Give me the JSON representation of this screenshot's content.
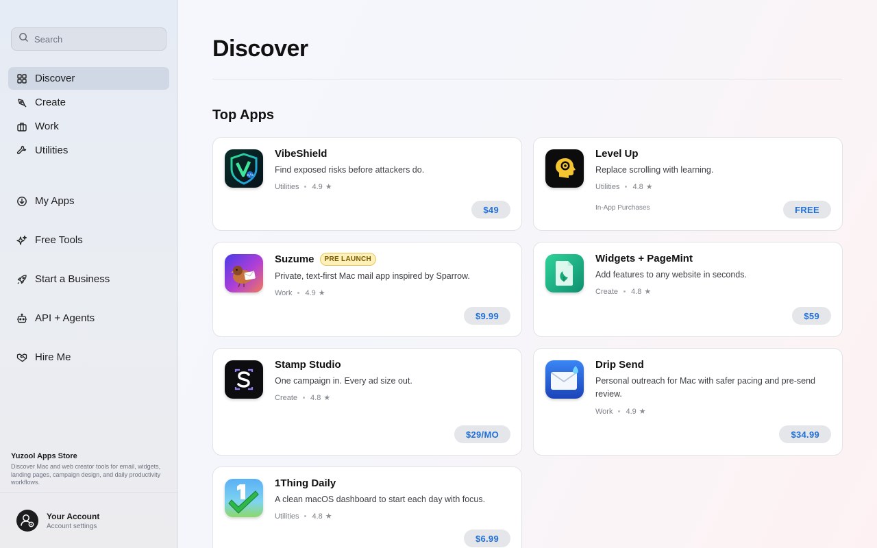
{
  "sidebar": {
    "search_placeholder": "Search",
    "nav": [
      {
        "label": "Discover",
        "icon": "grid-icon"
      },
      {
        "label": "Create",
        "icon": "pen-tool-icon"
      },
      {
        "label": "Work",
        "icon": "briefcase-icon"
      },
      {
        "label": "Utilities",
        "icon": "wrench-icon"
      },
      {
        "label": "My Apps",
        "icon": "download-circle-icon"
      },
      {
        "label": "Free Tools",
        "icon": "sparkles-icon"
      },
      {
        "label": "Start a Business",
        "icon": "rocket-icon"
      },
      {
        "label": "API + Agents",
        "icon": "robot-icon"
      },
      {
        "label": "Hire Me",
        "icon": "handshake-icon"
      }
    ],
    "store_title": "Yuzool Apps Store",
    "store_desc": "Discover Mac and web creator tools for email, widgets, landing pages, campaign design, and daily productivity workflows.",
    "account_name": "Your Account",
    "account_sub": "Account settings"
  },
  "main": {
    "title": "Discover",
    "section_title": "Top Apps",
    "apps": [
      {
        "name": "VibeShield",
        "desc": "Find exposed risks before attackers do.",
        "category": "Utilities",
        "rating": "4.9",
        "price": "$49"
      },
      {
        "name": "Level Up",
        "desc": "Replace scrolling with learning.",
        "category": "Utilities",
        "rating": "4.8",
        "extra": "In-App Purchases",
        "price": "FREE"
      },
      {
        "name": "Suzume",
        "badge": "PRE LAUNCH",
        "desc": "Private, text-first Mac mail app inspired by Sparrow.",
        "category": "Work",
        "rating": "4.9",
        "price": "$9.99"
      },
      {
        "name": "Widgets + PageMint",
        "desc": "Add features to any website in seconds.",
        "category": "Create",
        "rating": "4.8",
        "price": "$59"
      },
      {
        "name": "Stamp Studio",
        "desc": "One campaign in. Every ad size out.",
        "category": "Create",
        "rating": "4.8",
        "price": "$29/MO"
      },
      {
        "name": "Drip Send",
        "desc": "Personal outreach for Mac with safer pacing and pre-send review.",
        "category": "Work",
        "rating": "4.9",
        "price": "$34.99"
      },
      {
        "name": "1Thing Daily",
        "desc": "A clean macOS dashboard to start each day with focus.",
        "category": "Utilities",
        "rating": "4.8",
        "price": "$6.99"
      }
    ]
  },
  "colors": {
    "accent": "#1f6fd8",
    "badge_bg": "#fdf0b8"
  }
}
